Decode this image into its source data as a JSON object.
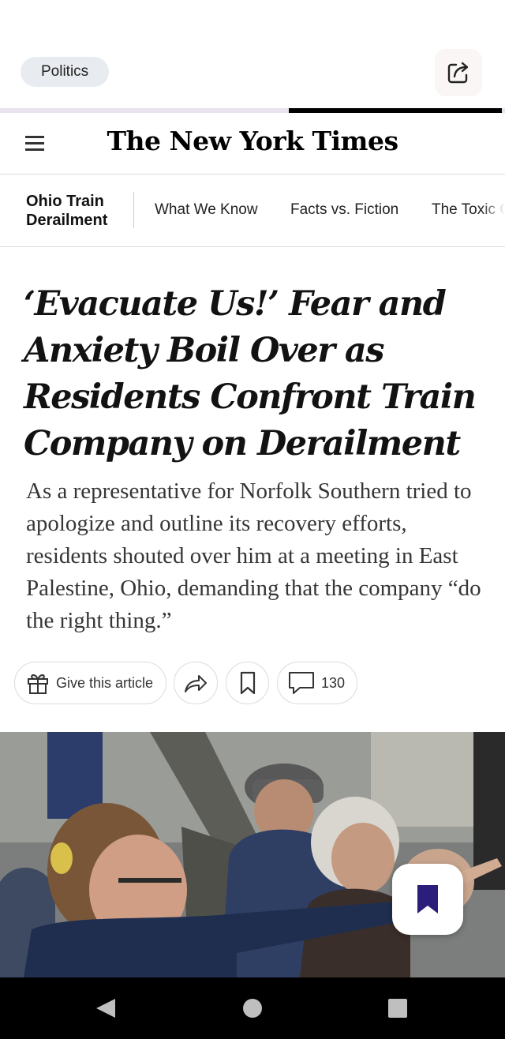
{
  "header": {
    "section_pill": "Politics"
  },
  "reading_progress": 0.58,
  "masthead": {
    "logo_text": "The New York Times"
  },
  "topics": {
    "title": "Ohio Train Derailment",
    "links": [
      "What We Know",
      "Facts vs. Fiction",
      "The Toxic C"
    ]
  },
  "article": {
    "headline": "‘Evacuate Us!’ Fear and Anxiety Boil Over as Residents Confront Train Company on Derailment",
    "summary": "As a representative for Norfolk Southern tried to apologize and outline its recovery efforts, residents shouted over him at a meeting in East Palestine, Ohio, demanding that the company “do the right thing.”"
  },
  "actions": {
    "gift_label": "Give this article",
    "comments_count": "130"
  },
  "icons": [
    "share-box-icon",
    "hamburger-menu-icon",
    "gift-icon",
    "share-arrow-icon",
    "bookmark-icon",
    "comment-icon",
    "bookmark-filled-icon",
    "back-nav-icon",
    "home-nav-icon",
    "recents-nav-icon"
  ],
  "colors": {
    "accent_bookmark": "#2b1d7a",
    "progress": "#000000"
  }
}
